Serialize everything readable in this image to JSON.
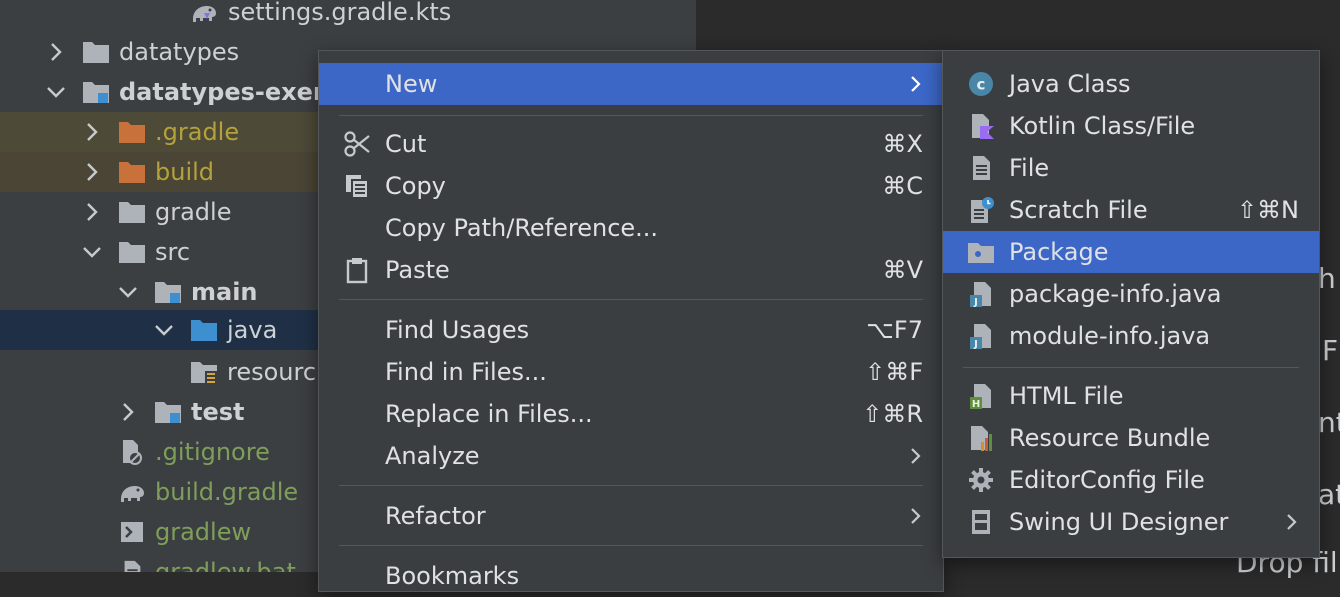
{
  "tree": {
    "rows": [
      {
        "label": "settings.gradle.kts",
        "icon": "gradle-elephant-icon"
      },
      {
        "label": "datatypes",
        "icon": "folder-icon"
      },
      {
        "label": "datatypes-exer",
        "icon": "module-folder-icon"
      },
      {
        "label": ".gradle",
        "icon": "folder-orange-icon"
      },
      {
        "label": "build",
        "icon": "folder-orange-icon"
      },
      {
        "label": "gradle",
        "icon": "folder-icon"
      },
      {
        "label": "src",
        "icon": "folder-icon"
      },
      {
        "label": "main",
        "icon": "source-root-folder-icon"
      },
      {
        "label": "java",
        "icon": "folder-blue-icon"
      },
      {
        "label": "resourc",
        "icon": "resources-folder-icon"
      },
      {
        "label": "test",
        "icon": "source-root-folder-icon"
      },
      {
        "label": ".gitignore",
        "icon": "ignore-file-icon"
      },
      {
        "label": "build.gradle",
        "icon": "gradle-elephant-icon"
      },
      {
        "label": "gradlew",
        "icon": "terminal-file-icon"
      },
      {
        "label": "gradlew.bat",
        "icon": "file-icon"
      }
    ]
  },
  "editor": {
    "fragments": [
      "h",
      "F",
      "nt",
      "at",
      "Drop fil"
    ]
  },
  "context_menu": {
    "items": [
      {
        "label": "New",
        "shortcut": "",
        "submenu": true,
        "selected": true
      },
      {
        "label": "Cut",
        "shortcut": "⌘X",
        "icon": "scissors-icon"
      },
      {
        "label": "Copy",
        "shortcut": "⌘C",
        "icon": "copy-icon"
      },
      {
        "label": "Copy Path/Reference...",
        "shortcut": ""
      },
      {
        "label": "Paste",
        "shortcut": "⌘V",
        "icon": "clipboard-icon"
      },
      {
        "label": "Find Usages",
        "shortcut": "⌥F7"
      },
      {
        "label": "Find in Files...",
        "shortcut": "⇧⌘F"
      },
      {
        "label": "Replace in Files...",
        "shortcut": "⇧⌘R"
      },
      {
        "label": "Analyze",
        "submenu": true
      },
      {
        "label": "Refactor",
        "submenu": true
      },
      {
        "label": "Bookmarks",
        "submenu": true
      }
    ]
  },
  "new_submenu": {
    "items": [
      {
        "label": "Java Class",
        "icon": "java-class-icon"
      },
      {
        "label": "Kotlin Class/File",
        "icon": "kotlin-file-icon"
      },
      {
        "label": "File",
        "icon": "file-icon"
      },
      {
        "label": "Scratch File",
        "shortcut": "⇧⌘N",
        "icon": "scratch-file-icon"
      },
      {
        "label": "Package",
        "icon": "package-icon",
        "selected": true
      },
      {
        "label": "package-info.java",
        "icon": "java-file-icon"
      },
      {
        "label": "module-info.java",
        "icon": "java-file-icon"
      },
      {
        "label": "HTML File",
        "icon": "html-file-icon"
      },
      {
        "label": "Resource Bundle",
        "icon": "resource-bundle-icon"
      },
      {
        "label": "EditorConfig File",
        "icon": "gear-icon"
      },
      {
        "label": "Swing UI Designer",
        "icon": "swing-designer-icon",
        "submenu": true
      }
    ]
  },
  "colors": {
    "selection": "#3c67c7",
    "tree_selection": "#1f3046",
    "excluded_folder": "#c9713a",
    "excluded_text": "#b5a23c",
    "vcs_added_text": "#7e9e5a"
  }
}
